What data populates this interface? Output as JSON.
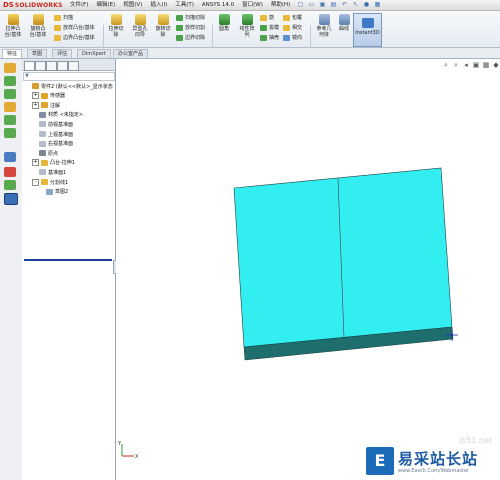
{
  "app": {
    "logo_mark": "DS",
    "logo_text": "SOLIDWORKS"
  },
  "menu": [
    "文件(F)",
    "编辑(E)",
    "视图(V)",
    "插入(I)",
    "工具(T)",
    "ANSYS 14.0",
    "窗口(W)",
    "帮助(H)"
  ],
  "ribbon": {
    "big_buttons": [
      {
        "label": "拉伸凸\n台/基体"
      },
      {
        "label": "旋转凸\n台/基体"
      },
      {
        "label": "拉伸切\n除"
      },
      {
        "label": "异型孔\n向导"
      },
      {
        "label": "旋转切\n除"
      },
      {
        "label": "圆角"
      },
      {
        "label": "线性阵\n列"
      },
      {
        "label": "参考几\n何体"
      },
      {
        "label": "曲线"
      }
    ],
    "small_group1": [
      "扫描",
      "放样凸台/基体",
      "边界凸台/基体"
    ],
    "small_group2": [
      "扫描切除",
      "放样切割",
      "边界切除"
    ],
    "small_group3": [
      "筋",
      "拔模",
      "抽壳"
    ],
    "small_group4": [
      "包覆",
      "相交",
      "镜向"
    ],
    "instant3d": "Instant3D"
  },
  "cm_tabs": [
    "特征",
    "草图",
    "评估",
    "DimXpert",
    "办公室产品"
  ],
  "tree": [
    {
      "label": "零件2 (默认<<默认>_显示状态",
      "indent": 0,
      "expander": "",
      "color": "#d69c2f"
    },
    {
      "label": "传感器",
      "indent": 1,
      "expander": "+",
      "color": "#e0a528"
    },
    {
      "label": "注解",
      "indent": 1,
      "expander": "+",
      "color": "#e0a528"
    },
    {
      "label": "材质 <未指定>",
      "indent": 1,
      "expander": "",
      "color": "#7f8ca3"
    },
    {
      "label": "前视基准面",
      "indent": 1,
      "expander": "",
      "color": "#b3bccb"
    },
    {
      "label": "上视基准面",
      "indent": 1,
      "expander": "",
      "color": "#b3bccb"
    },
    {
      "label": "右视基准面",
      "indent": 1,
      "expander": "",
      "color": "#b3bccb"
    },
    {
      "label": "原点",
      "indent": 1,
      "expander": "",
      "color": "#7d8594"
    },
    {
      "label": "凸台-拉伸1",
      "indent": 1,
      "expander": "+",
      "color": "#e6b53a"
    },
    {
      "label": "基准面1",
      "indent": 1,
      "expander": "",
      "color": "#b3bccb"
    },
    {
      "label": "分割线1",
      "indent": 1,
      "expander": "-",
      "color": "#e6b53a"
    },
    {
      "label": "草图2",
      "indent": 2,
      "expander": "",
      "color": "#8fa3c2"
    }
  ],
  "watermark": {
    "site": "jb51.net",
    "logo_glyph": "E",
    "title": "易采站长站",
    "url": "www.Easck.Com/Webmaster"
  },
  "colors": {
    "model_face": "#33eef0",
    "model_side": "#1e6e6e",
    "accent": "#c62a1f"
  },
  "triad": {
    "y": "Y",
    "x": "X"
  }
}
